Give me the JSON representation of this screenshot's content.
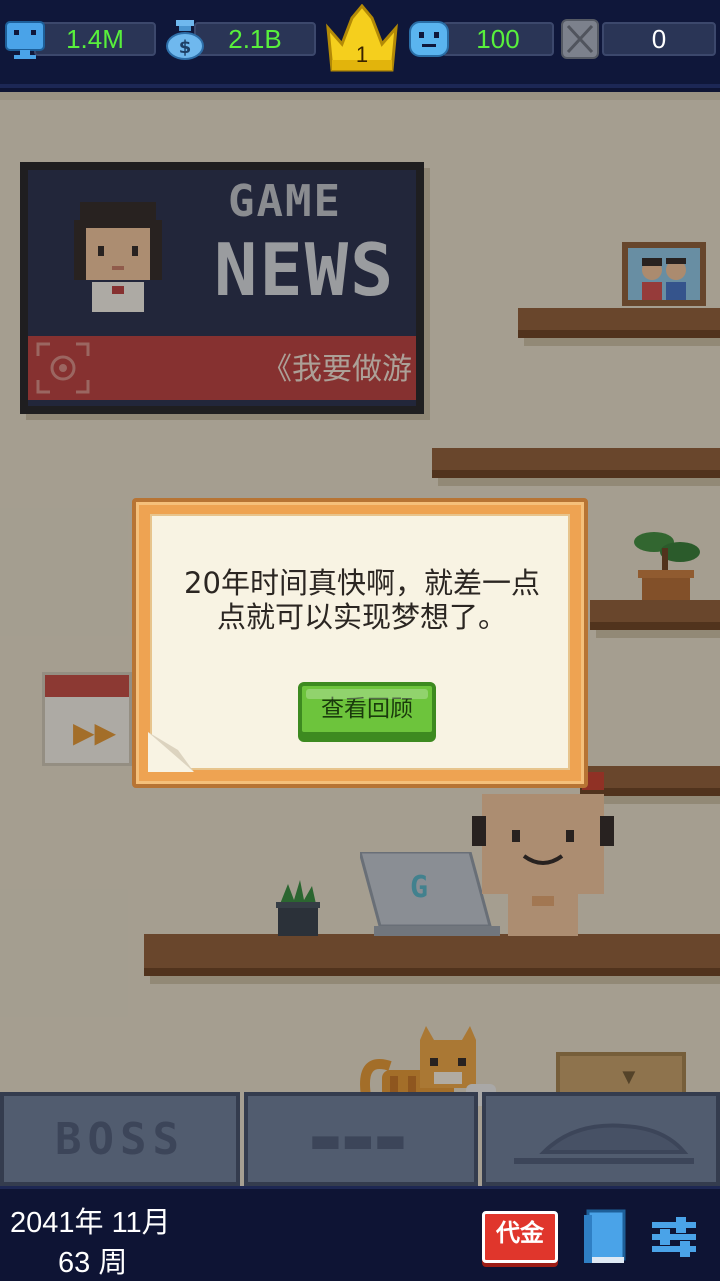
{
  "top_stats": {
    "fans": {
      "value": "1.4M",
      "icon": "fan-monitor-icon"
    },
    "money": {
      "value": "2.1B",
      "icon": "money-bag-icon"
    },
    "rank": {
      "value": "1",
      "icon": "crown-icon"
    },
    "staff": {
      "value": "100",
      "icon": "smiley-face-icon"
    },
    "blocked": {
      "value": "0",
      "icon": "locked-slot-icon"
    }
  },
  "news_board": {
    "title_line1": "GAME",
    "title_line2": "NEWS",
    "ticker": "《我要做游"
  },
  "dialog": {
    "message": "20年时间真快啊，就差一点点就可以实现梦想了。",
    "button_label": "查看回顾"
  },
  "scene_tabs": {
    "boss": "BOSS",
    "rooms": "▬▬▬",
    "car": ""
  },
  "laptop_logo": "G",
  "bottom_bar": {
    "date": "2041年 11月",
    "week": "63 周",
    "voucher_label": "代金"
  },
  "colors": {
    "bar_bg": "#0e1434",
    "stat_value": "#58f03c",
    "dialog_orange": "#eea352",
    "button_green": "#6dc43c",
    "voucher_red": "#e0362c"
  }
}
